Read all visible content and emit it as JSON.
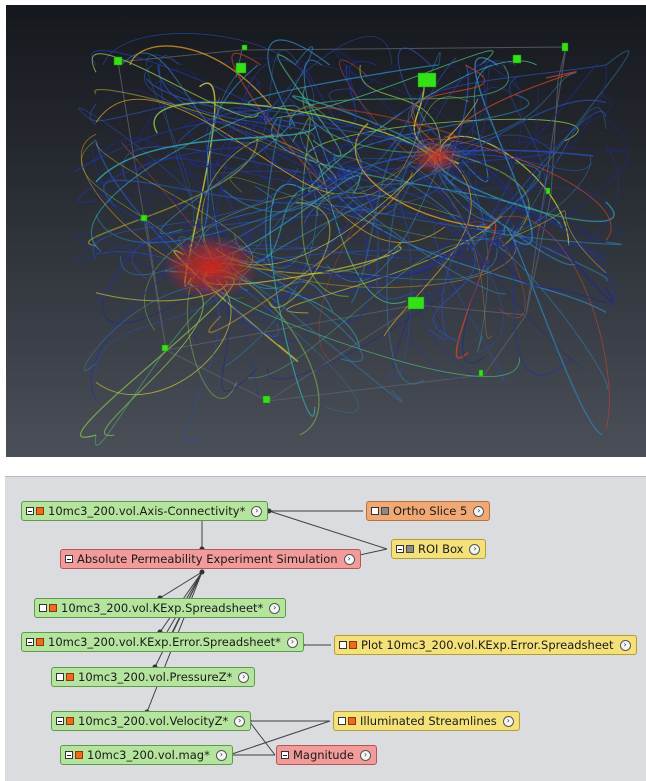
{
  "nodes": [
    {
      "id": "n1",
      "label": "10mc3_200.vol.Axis-Connectivity*",
      "type": "data",
      "icons": [
        "minus",
        "orange"
      ]
    },
    {
      "id": "n2",
      "label": "Absolute Permeability Experiment Simulation",
      "type": "compute",
      "icons": [
        "minus"
      ]
    },
    {
      "id": "n3",
      "label": "10mc3_200.vol.KExp.Spreadsheet*",
      "type": "data",
      "icons": [
        "white",
        "orange"
      ]
    },
    {
      "id": "n4",
      "label": "10mc3_200.vol.KExp.Error.Spreadsheet*",
      "type": "data",
      "icons": [
        "minus",
        "orange"
      ]
    },
    {
      "id": "n5",
      "label": "10mc3_200.vol.PressureZ*",
      "type": "data",
      "icons": [
        "white",
        "orange"
      ]
    },
    {
      "id": "n6",
      "label": "10mc3_200.vol.VelocityZ*",
      "type": "data",
      "icons": [
        "minus",
        "orange"
      ]
    },
    {
      "id": "n7",
      "label": "10mc3_200.vol.mag*",
      "type": "data",
      "icons": [
        "minus",
        "orange"
      ]
    },
    {
      "id": "n8",
      "label": "Ortho Slice 5",
      "type": "module",
      "icons": [
        "white",
        "gray"
      ]
    },
    {
      "id": "n9",
      "label": "ROI Box",
      "type": "display",
      "icons": [
        "minus",
        "gray"
      ]
    },
    {
      "id": "n10",
      "label": "Plot 10mc3_200.vol.KExp.Error.Spreadsheet",
      "type": "display",
      "icons": [
        "white",
        "orange"
      ]
    },
    {
      "id": "n11",
      "label": "Illuminated Streamlines",
      "type": "display",
      "icons": [
        "white",
        "orange"
      ]
    },
    {
      "id": "n12",
      "label": "Magnitude",
      "type": "compute",
      "icons": [
        "minus"
      ]
    }
  ],
  "colors": {
    "data": "#b5e49f",
    "compute": "#f19b9b",
    "display": "#f4e17a",
    "module": "#f0a874"
  }
}
